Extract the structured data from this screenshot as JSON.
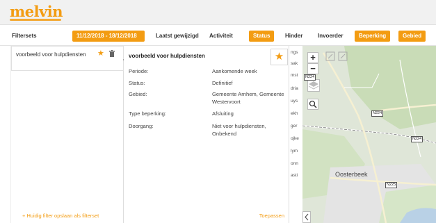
{
  "app": {
    "logo": "melvin"
  },
  "toolbar": {
    "filtersets_label": "Filtersets",
    "date_range": "11/12/2018 - 18/12/2018",
    "last_modified": "Laatst gewijzigd",
    "activity": "Activiteit",
    "status": "Status",
    "hinder": "Hinder",
    "invoerder": "Invoerder",
    "beperking": "Beperking",
    "gebied": "Gebied"
  },
  "filterset_list": {
    "items": [
      {
        "label": "voorbeeld voor hulpdiensten"
      }
    ],
    "save_link": "+ Huidig filter opslaan als filterset"
  },
  "detail": {
    "title": "voorbeeld voor hulpdiensten",
    "rows": [
      {
        "key": "Periode:",
        "value": "Aankomende week"
      },
      {
        "key": "Status:",
        "value": "Definitief"
      },
      {
        "key": "Gebied:",
        "value": "Gemeente Arnhem, Gemeente Westervoort"
      },
      {
        "key": "Type beperking:",
        "value": "Afsluiting"
      },
      {
        "key": "Doorgang:",
        "value": "Niet voor hulpdiensten, Onbekend"
      }
    ],
    "apply_label": "Toepassen"
  },
  "peek_column": [
    "ngs",
    "sak",
    "mst",
    "dria",
    "uys",
    "ekh",
    "ger",
    "ojke",
    "lym",
    "onn",
    "asti"
  ],
  "map": {
    "place_label": "Oosterbeek",
    "road_tags": [
      "N224",
      "N224",
      "N224",
      "N225"
    ],
    "zoom_in": "+",
    "zoom_out": "−",
    "colors": {
      "bg": "#dfe6d8",
      "forest": "#c9dcb7",
      "urban": "#e4e4e4",
      "road": "#f6f0d2",
      "water": "#b9d1e6"
    }
  },
  "colors": {
    "accent": "#f39c12"
  }
}
